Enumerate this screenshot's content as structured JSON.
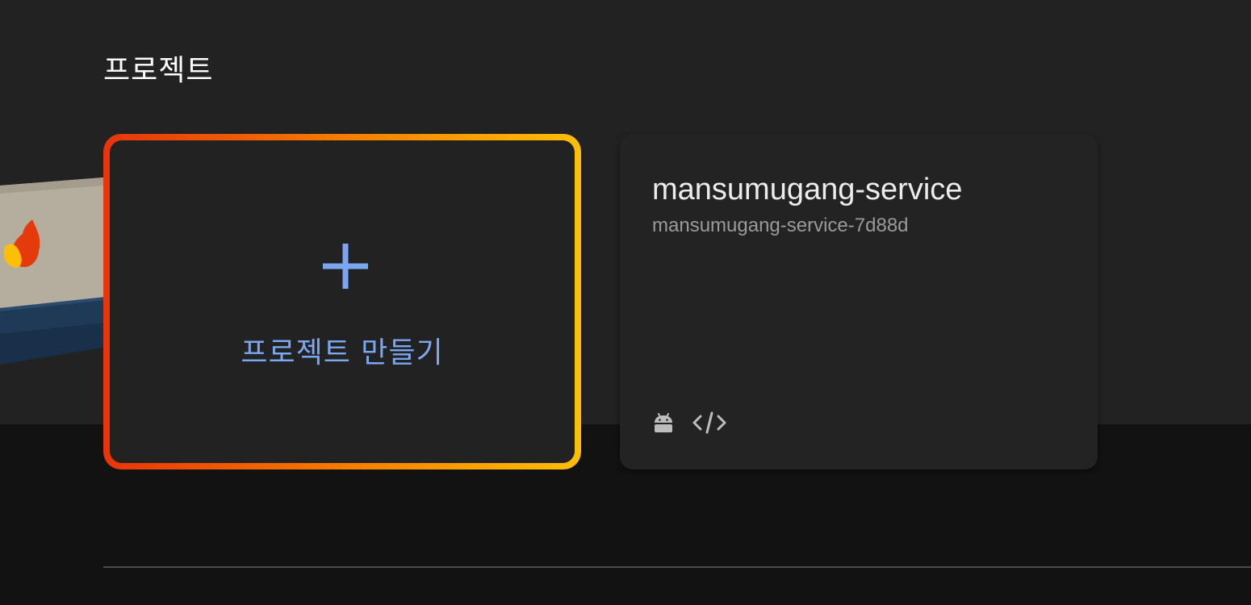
{
  "section": {
    "title": "프로젝트"
  },
  "create_card": {
    "label": "프로젝트 만들기",
    "icon": "plus-icon"
  },
  "projects": [
    {
      "name": "mansumugang-service",
      "id": "mansumugang-service-7d88d",
      "platforms": [
        "android-icon",
        "web-code-icon"
      ]
    }
  ],
  "colors": {
    "background_top": "#222222",
    "background_bottom": "#121212",
    "accent_link": "#7aa7f0",
    "gradient_start": "#e8340c",
    "gradient_end": "#fcbf06"
  }
}
